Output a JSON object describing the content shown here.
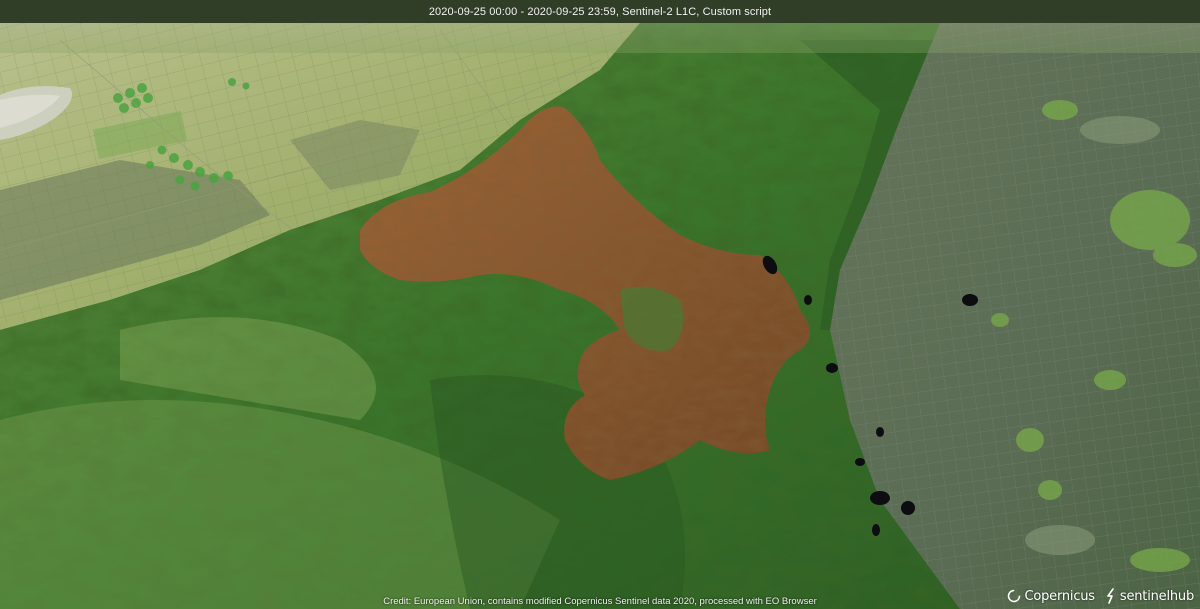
{
  "header": {
    "title": "2020-09-25 00:00 - 2020-09-25 23:59, Sentinel-2 L1C, Custom script"
  },
  "footer": {
    "credit": "Credit: European Union, contains modified Copernicus Sentinel data 2020, processed with EO Browser"
  },
  "logos": {
    "copernicus": "Copernicus",
    "sentinelhub": "sentinelhub"
  },
  "colors": {
    "vegetation": "#3f7a2e",
    "burn_scar": "#9a5a2e",
    "desert": "#b7c07e",
    "urban": "#6e7f66",
    "water": "#0d0d12"
  }
}
